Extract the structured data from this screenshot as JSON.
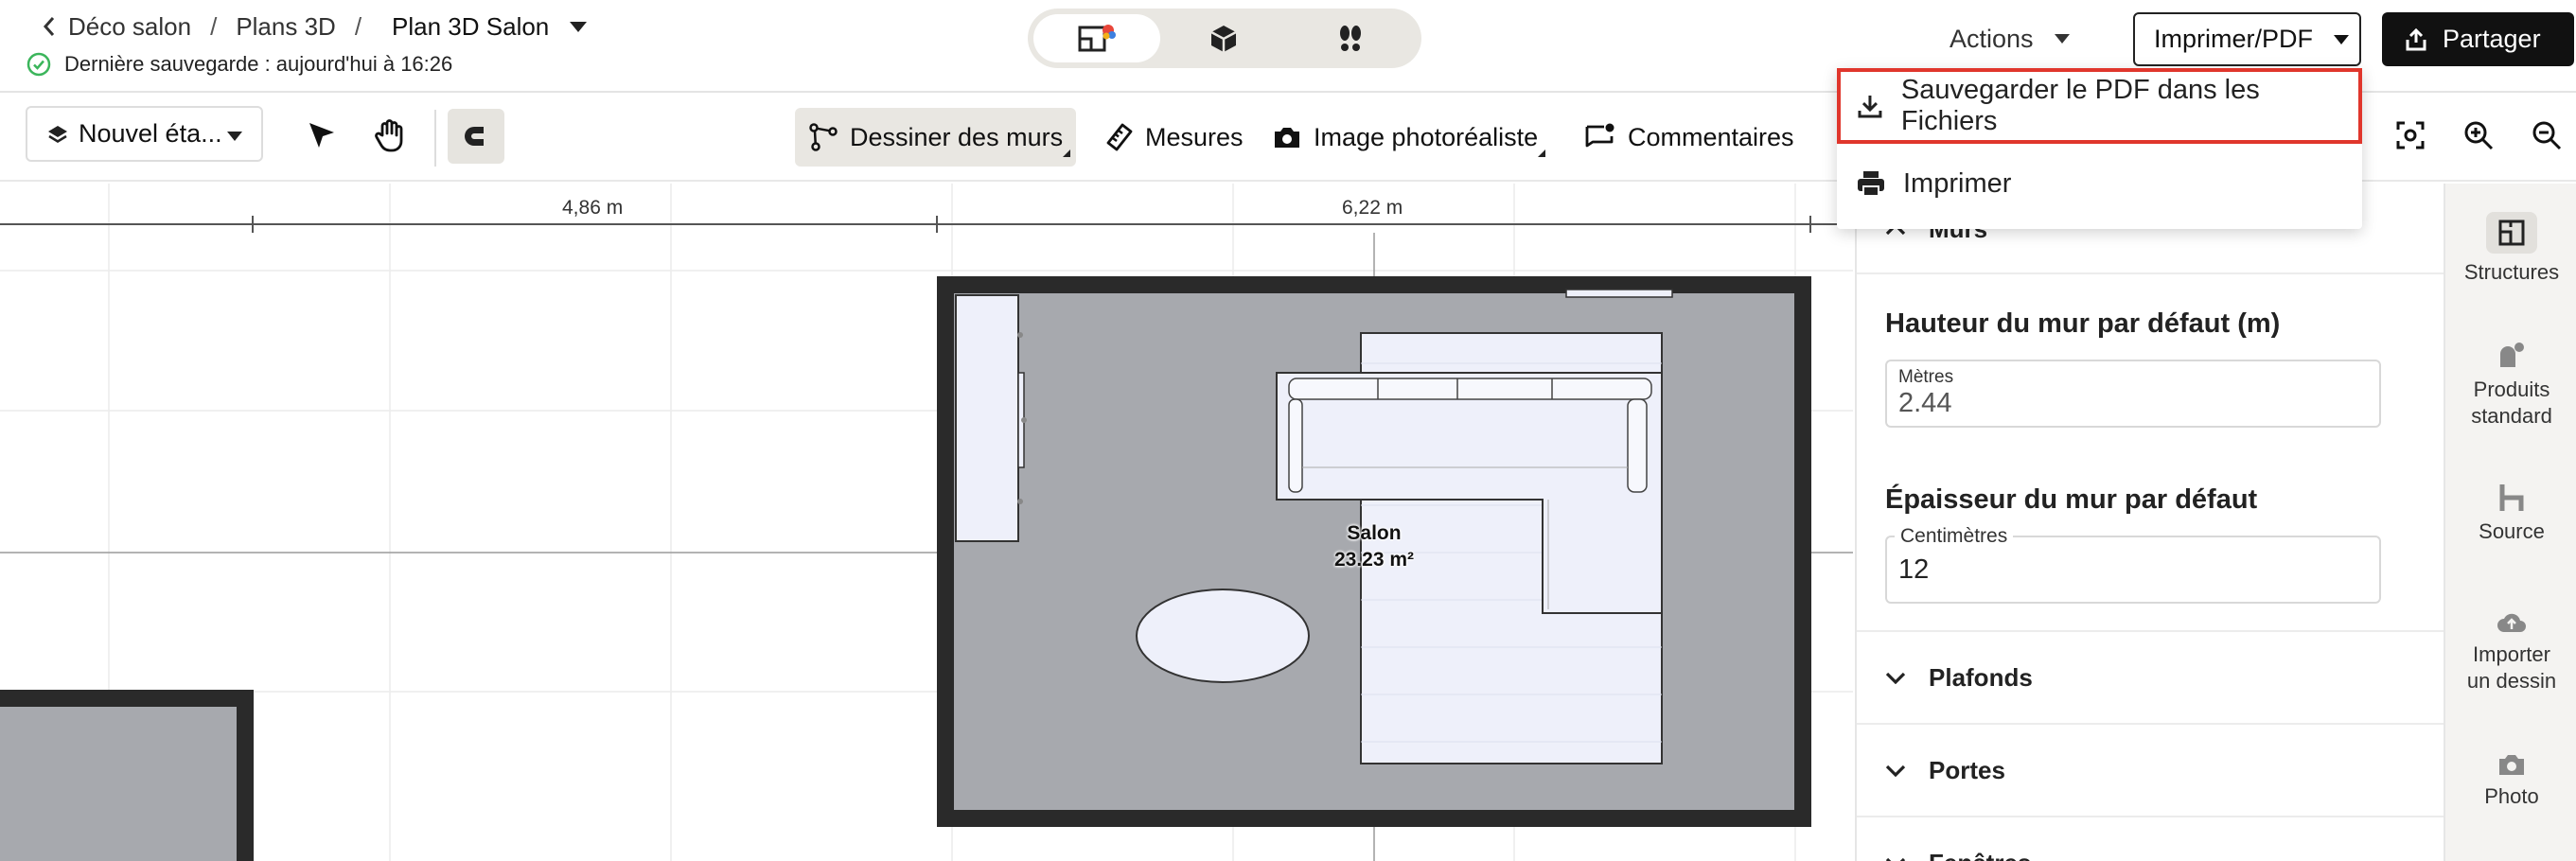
{
  "header": {
    "breadcrumb": [
      "Déco salon",
      "Plans 3D"
    ],
    "separator": "/",
    "current": "Plan 3D Salon",
    "save_status": "Dernière sauvegarde : aujourd'hui à 16:26",
    "actions_label": "Actions",
    "print_label": "Imprimer/PDF",
    "share_label": "Partager"
  },
  "toolbar": {
    "floor_label": "Nouvel éta...",
    "draw_walls_label": "Dessiner des murs",
    "measures_label": "Mesures",
    "photoreal_label": "Image photoréaliste",
    "comments_label": "Commentaires"
  },
  "canvas": {
    "ruler_labels": [
      "4,86 m",
      "6,22 m"
    ],
    "room_name": "Salon",
    "room_area": "23.23 m²"
  },
  "panel": {
    "top_section_partial": "Murs",
    "wall_height_title": "Hauteur du mur par défaut (m)",
    "wall_height_unit": "Mètres",
    "wall_height_value": "2.44",
    "wall_thickness_title": "Épaisseur du mur par défaut",
    "wall_thickness_unit": "Centimètres",
    "wall_thickness_value": "12",
    "sections": [
      "Plafonds",
      "Portes",
      "Fenêtres"
    ]
  },
  "rail": {
    "items": [
      "Structures",
      "Produits standard",
      "Source",
      "Importer un dessin",
      "Photo"
    ]
  },
  "dropdown": {
    "items": [
      "Sauvegarder le PDF dans les Fichiers",
      "Imprimer"
    ],
    "highlight_color": "#e0362c"
  },
  "colors": {
    "wall": "#2a2a2a",
    "floor": "#a7a9ae",
    "furniture": "#eef0fa",
    "saved_check": "#3bb55b"
  }
}
